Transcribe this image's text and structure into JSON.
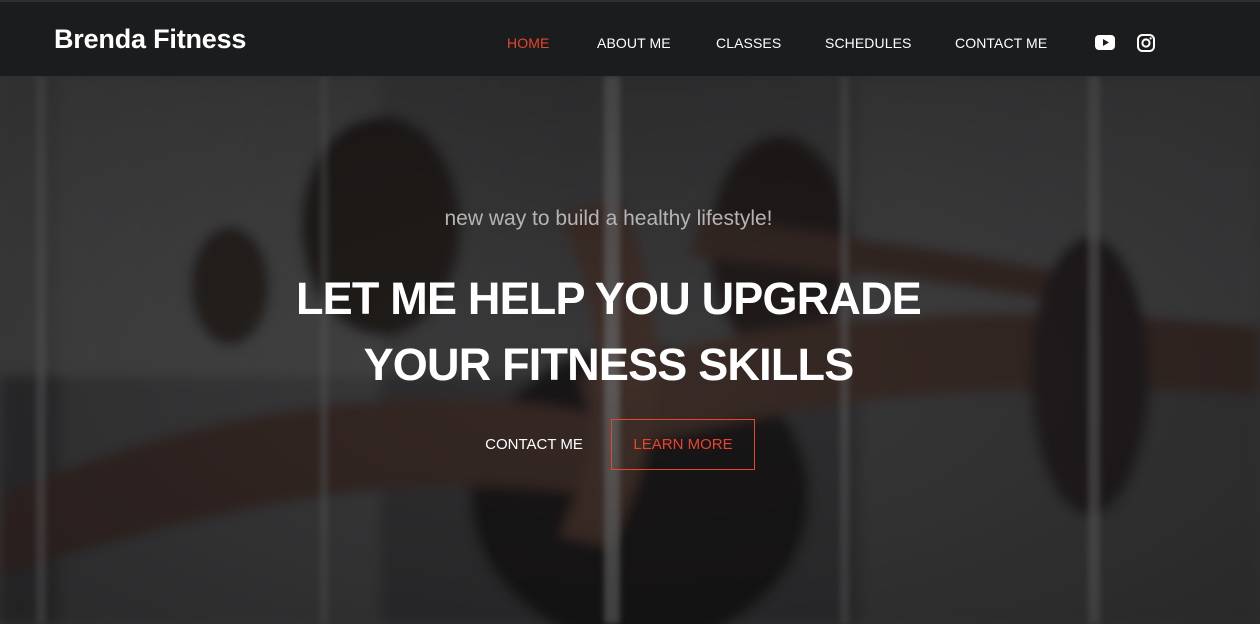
{
  "brand": {
    "name": "Brenda Fitness"
  },
  "nav": {
    "items": [
      {
        "label": "HOME",
        "active": true
      },
      {
        "label": "ABOUT ME",
        "active": false
      },
      {
        "label": "CLASSES",
        "active": false
      },
      {
        "label": "SCHEDULES",
        "active": false
      },
      {
        "label": "CONTACT ME",
        "active": false
      }
    ],
    "social": [
      "youtube-icon",
      "instagram-icon"
    ]
  },
  "hero": {
    "tagline": "new way to build a healthy lifestyle!",
    "headline_line1": "LET ME HELP YOU UPGRADE",
    "headline_line2": "YOUR FITNESS SKILLS",
    "primary_button": "CONTACT ME",
    "secondary_button": "LEARN MORE"
  },
  "colors": {
    "accent": "#e8452c",
    "header_bg": "#1b1c1e",
    "text": "#ffffff"
  }
}
